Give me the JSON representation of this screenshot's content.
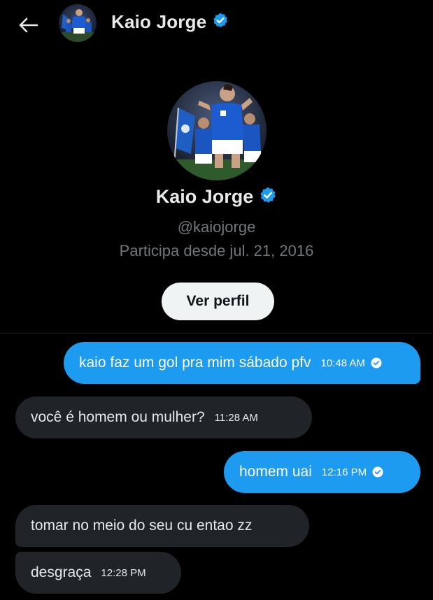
{
  "header": {
    "back_icon": "arrow-left-icon",
    "name": "Kaio Jorge",
    "verified_icon": "verified-badge-icon"
  },
  "profile": {
    "name": "Kaio Jorge",
    "handle": "@kaiojorge",
    "joined": "Participa desde jul. 21, 2016",
    "view_profile_label": "Ver perfil"
  },
  "messages": [
    {
      "direction": "sent",
      "text": "kaio faz um gol pra mim sábado pfv",
      "time": "10:48 AM",
      "read": true
    },
    {
      "direction": "received",
      "text": "você é homem ou mulher?",
      "time": "11:28 AM"
    },
    {
      "direction": "sent",
      "text": "homem uai",
      "time": "12:16 PM",
      "read": true
    },
    {
      "direction": "received",
      "text": "tomar no meio do seu cu entao zz",
      "time": ""
    },
    {
      "direction": "received",
      "text": "desgraça",
      "time": "12:28 PM"
    }
  ],
  "colors": {
    "background": "#000000",
    "sent_bubble": "#1d9bf0",
    "received_bubble": "#202327",
    "secondary_text": "#71767b",
    "verified": "#1d9bf0"
  }
}
